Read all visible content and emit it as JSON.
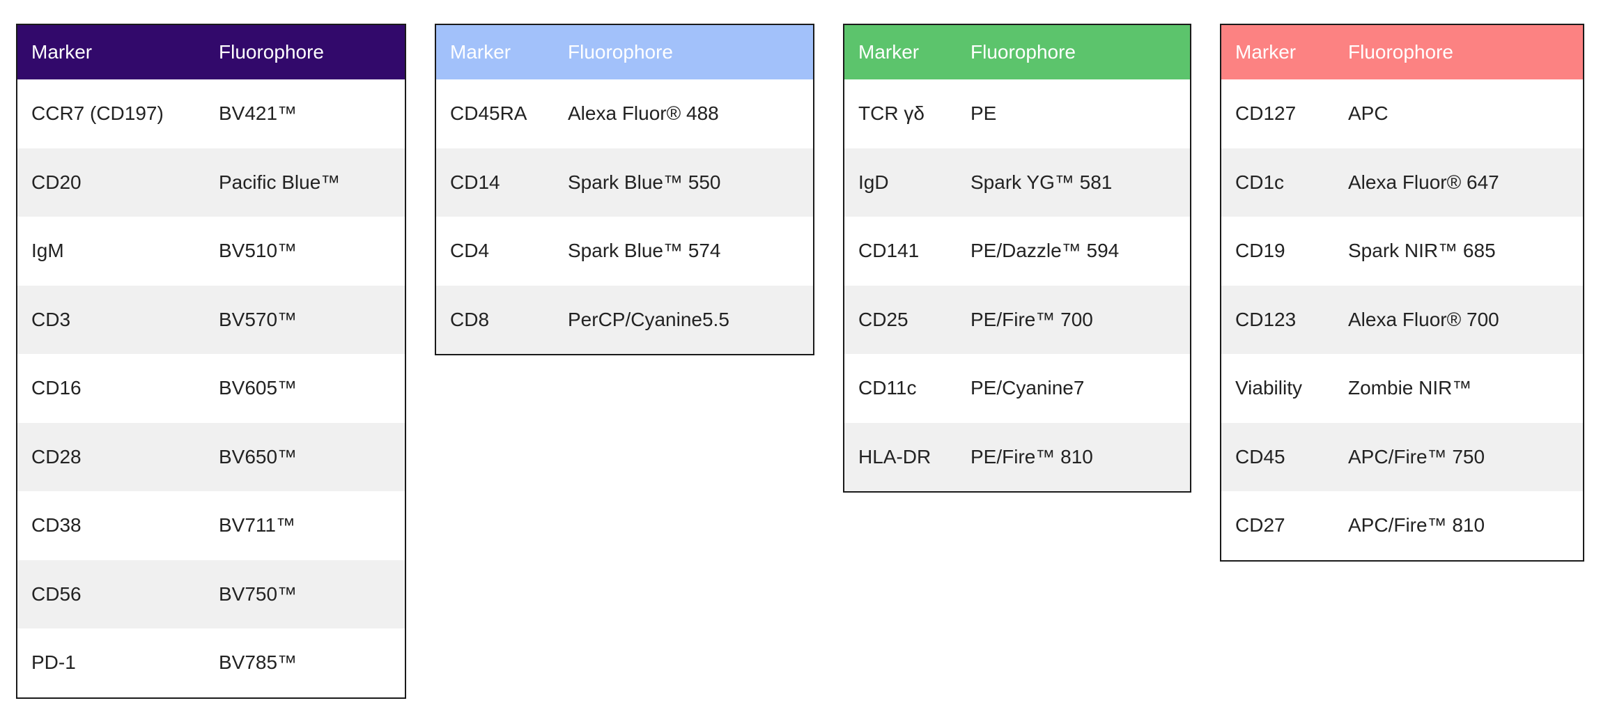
{
  "panels": [
    {
      "header_color": "#32096b",
      "marker_label": "Marker",
      "fluor_label": "Fluorophore",
      "rows": [
        {
          "marker": "CCR7 (CD197)",
          "fluor": "BV421™"
        },
        {
          "marker": "CD20",
          "fluor": "Pacific Blue™"
        },
        {
          "marker": "IgM",
          "fluor": "BV510™"
        },
        {
          "marker": "CD3",
          "fluor": "BV570™"
        },
        {
          "marker": "CD16",
          "fluor": "BV605™"
        },
        {
          "marker": "CD28",
          "fluor": "BV650™"
        },
        {
          "marker": "CD38",
          "fluor": "BV711™"
        },
        {
          "marker": "CD56",
          "fluor": "BV750™"
        },
        {
          "marker": "PD-1",
          "fluor": "BV785™"
        }
      ]
    },
    {
      "header_color": "#a2c1fa",
      "marker_label": "Marker",
      "fluor_label": "Fluorophore",
      "rows": [
        {
          "marker": "CD45RA",
          "fluor": "Alexa Fluor® 488"
        },
        {
          "marker": "CD14",
          "fluor": "Spark Blue™ 550"
        },
        {
          "marker": "CD4",
          "fluor": "Spark Blue™ 574"
        },
        {
          "marker": "CD8",
          "fluor": "PerCP/Cyanine5.5"
        }
      ]
    },
    {
      "header_color": "#5cc46c",
      "marker_label": "Marker",
      "fluor_label": "Fluorophore",
      "rows": [
        {
          "marker": "TCR γδ",
          "fluor": "PE"
        },
        {
          "marker": "IgD",
          "fluor": "Spark YG™ 581"
        },
        {
          "marker": "CD141",
          "fluor": "PE/Dazzle™ 594"
        },
        {
          "marker": "CD25",
          "fluor": "PE/Fire™ 700"
        },
        {
          "marker": "CD11c",
          "fluor": "PE/Cyanine7"
        },
        {
          "marker": "HLA-DR",
          "fluor": "PE/Fire™ 810"
        }
      ]
    },
    {
      "header_color": "#fc8282",
      "marker_label": "Marker",
      "fluor_label": "Fluorophore",
      "rows": [
        {
          "marker": "CD127",
          "fluor": "APC"
        },
        {
          "marker": "CD1c",
          "fluor": "Alexa Fluor® 647"
        },
        {
          "marker": "CD19",
          "fluor": "Spark NIR™ 685"
        },
        {
          "marker": "CD123",
          "fluor": "Alexa Fluor® 700"
        },
        {
          "marker": "Viability",
          "fluor": "Zombie NIR™"
        },
        {
          "marker": "CD45",
          "fluor": "APC/Fire™ 750"
        },
        {
          "marker": "CD27",
          "fluor": "APC/Fire™ 810"
        }
      ]
    }
  ]
}
